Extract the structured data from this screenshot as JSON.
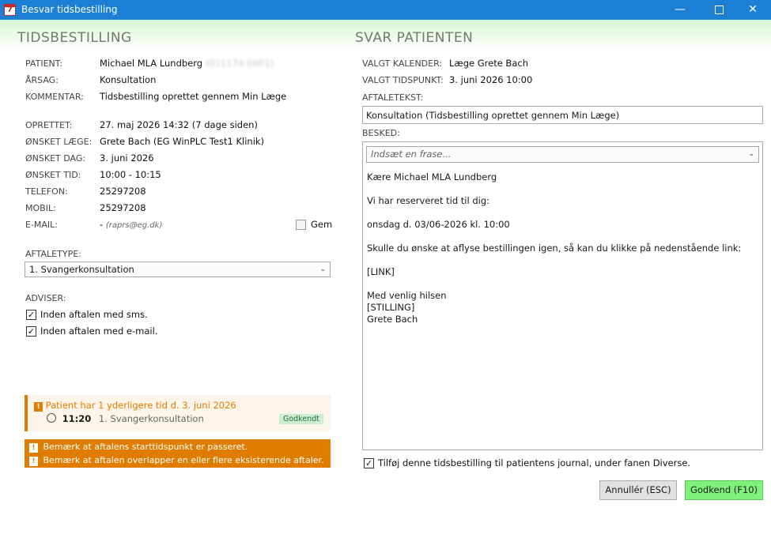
{
  "window": {
    "title": "Besvar tidsbestilling",
    "icon_label": "7"
  },
  "left": {
    "title": "TIDSBESTILLING",
    "patient_label": "PATIENT:",
    "patient_name": "Michael MLA Lundberg",
    "patient_id_redacted": "(011174-0001)",
    "reason_label": "ÅRSAG:",
    "reason_value": "Konsultation",
    "comment_label": "KOMMENTAR:",
    "comment_value": "Tidsbestilling oprettet gennem Min Læge",
    "created_label": "OPRETTET:",
    "created_value": "27. maj 2026 14:32 (7 dage siden)",
    "doctor_label": "ØNSKET LÆGE:",
    "doctor_value": "Grete Bach (EG WinPLC Test1 Klinik)",
    "day_label": "ØNSKET DAG:",
    "day_value": "3. juni 2026",
    "time_label": "ØNSKET TID:",
    "time_value": "10:00 - 10:15",
    "phone_label": "TELEFON:",
    "phone_value": "25297208",
    "mobile_label": "MOBIL:",
    "mobile_value": "25297208",
    "email_label": "E-MAIL:",
    "email_dash": "-",
    "email_value": "(raprs@eg.dk)",
    "save_label": "Gem",
    "appt_type_label": "AFTALETYPE:",
    "appt_type_value": "1. Svangerkonsultation",
    "notify_label": "ADVISER:",
    "notify_sms": "Inden aftalen med sms.",
    "notify_email": "Inden aftalen med e-mail.",
    "info_title": "Patient har 1 yderligere tid d. 3. juni 2026",
    "info_time": "11:20",
    "info_type": "1. Svangerkonsultation",
    "info_status": "Godkendt",
    "warning_1": "Bemærk at aftalens starttidspunkt er passeret.",
    "warning_2": "Bemærk at aftalen overlapper en eller flere eksisterende aftaler."
  },
  "right": {
    "title": "SVAR PATIENTEN",
    "calendar_label": "VALGT KALENDER:",
    "calendar_value": "Læge Grete Bach",
    "timeslot_label": "VALGT TIDSPUNKT:",
    "timeslot_value": "3. juni 2026 10:00",
    "appt_text_label": "AFTALETEKST:",
    "appt_text_value": "Konsultation (Tidsbestilling oprettet gennem Min Læge)",
    "message_label": "BESKED:",
    "phrase_placeholder": "Indsæt en frase...",
    "message_lines": {
      "greeting": "Kære Michael MLA Lundberg",
      "reserved": "Vi har reserveret tid til dig:",
      "when": "onsdag d. 03/06-2026 kl. 10:00",
      "cancel": "Skulle du ønske at aflyse bestillingen igen, så kan du klikke på nedenstående link:",
      "link": "[LINK]",
      "regards": "Med venlig hilsen",
      "position": "[STILLING]",
      "signer": "Grete Bach"
    },
    "journal_checkbox": "Tilføj denne tidsbestilling til patientens journal, under fanen Diverse.",
    "cancel_button": "Annullér (ESC)",
    "approve_button": "Godkend (F10)"
  },
  "colors": {
    "titlebar": "#1b7fd6",
    "accent_orange": "#e07c00",
    "approve_green": "#7ef27a"
  }
}
